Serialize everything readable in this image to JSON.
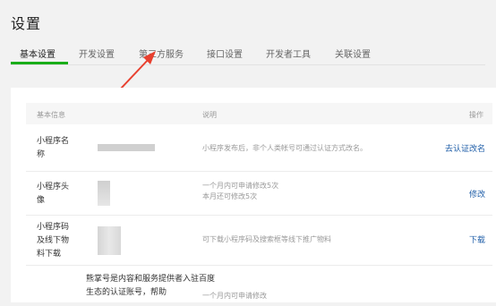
{
  "title": "设置",
  "tabs": [
    "基本设置",
    "开发设置",
    "第三方服务",
    "接口设置",
    "开发者工具",
    "关联设置"
  ],
  "table": {
    "headers": [
      "基本信息",
      "说明",
      "操作"
    ],
    "rows": [
      {
        "name": "小程序名称",
        "desc1": "小程序发布后，非个人类帐号可通过认证方式改名。",
        "desc2": "",
        "action": "去认证改名"
      },
      {
        "name": "小程序头像",
        "desc1": "一个月内可申请修改5次",
        "desc2": "本月还可修改5次",
        "action": "修改"
      },
      {
        "name": "小程序码及线下物料下载",
        "desc1": "可下载小程序码及搜索框等线下推广物料",
        "desc2": "",
        "action": "下载"
      },
      {
        "name": "熊掌号是内容和服务提供者入驻百度生态的认证账号，帮助",
        "desc1": "一个月内可申请修改",
        "desc2": "",
        "action": ""
      }
    ]
  },
  "colors": {
    "accent": "#1aad19",
    "link": "#1f5ea8",
    "arrow": "#e8402f"
  }
}
